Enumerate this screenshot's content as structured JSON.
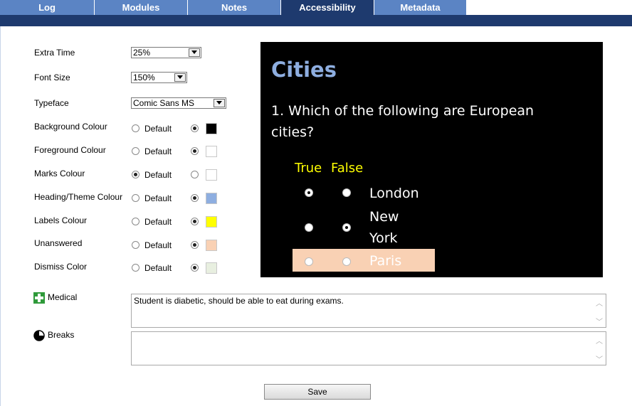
{
  "tabs": [
    {
      "label": "Log",
      "active": false
    },
    {
      "label": "Modules",
      "active": false
    },
    {
      "label": "Notes",
      "active": false
    },
    {
      "label": "Accessibility",
      "active": true
    },
    {
      "label": "Metadata",
      "active": false
    }
  ],
  "settings": {
    "extra_time": {
      "label": "Extra Time",
      "value": "25%"
    },
    "font_size": {
      "label": "Font Size",
      "value": "150%"
    },
    "typeface": {
      "label": "Typeface",
      "value": "Comic Sans MS"
    },
    "default_label": "Default",
    "colours": [
      {
        "label": "Background Colour",
        "selected": "custom",
        "color": "#000000"
      },
      {
        "label": "Foreground Colour",
        "selected": "custom",
        "color": "#ffffff"
      },
      {
        "label": "Marks Colour",
        "selected": "default",
        "color": "#ffffff"
      },
      {
        "label": "Heading/Theme Colour",
        "selected": "custom",
        "color": "#8eaee0"
      },
      {
        "label": "Labels Colour",
        "selected": "custom",
        "color": "#ffff00"
      },
      {
        "label": "Unanswered",
        "selected": "custom",
        "color": "#f9d1b4"
      },
      {
        "label": "Dismiss Color",
        "selected": "custom",
        "color": "#e8efe0"
      }
    ]
  },
  "preview": {
    "title": "Cities",
    "question": "1.  Which of the following are European cities?",
    "col_true": "True",
    "col_false": "False",
    "answers": [
      {
        "text": "London",
        "true_selected": true,
        "false_selected": false
      },
      {
        "text": "New York",
        "true_selected": false,
        "false_selected": true
      },
      {
        "text": "Paris",
        "true_selected": false,
        "false_selected": false,
        "unanswered": true
      }
    ]
  },
  "medical": {
    "label": "Medical",
    "icon": "medical-cross-icon",
    "value": "Student is diabetic, should be able to eat during exams."
  },
  "breaks": {
    "label": "Breaks",
    "icon": "clock-icon",
    "value": ""
  },
  "save_label": "Save"
}
